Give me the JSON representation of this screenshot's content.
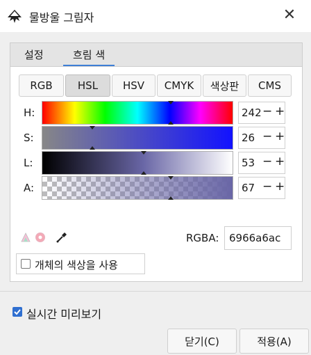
{
  "window": {
    "title": "물방울 그림자",
    "close_label": "✕"
  },
  "tabs": [
    {
      "label": "설정",
      "active": false
    },
    {
      "label": "흐림 색",
      "active": true
    }
  ],
  "color_modes": [
    {
      "label": "RGB",
      "active": false
    },
    {
      "label": "HSL",
      "active": true
    },
    {
      "label": "HSV",
      "active": false
    },
    {
      "label": "CMYK",
      "active": false
    },
    {
      "label": "색상판",
      "active": false
    },
    {
      "label": "CMS",
      "active": false
    }
  ],
  "sliders": [
    {
      "label": "H:",
      "value": "242"
    },
    {
      "label": "S:",
      "value": "26"
    },
    {
      "label": "L:",
      "value": "53"
    },
    {
      "label": "A:",
      "value": "67"
    }
  ],
  "spin": {
    "minus": "−",
    "plus": "+"
  },
  "rgba": {
    "label": "RGBA:",
    "value": "6966a6ac"
  },
  "object_color": {
    "label": "개체의 색상을 사용",
    "checked": false
  },
  "live_preview": {
    "label": "실시간 미리보기",
    "checked": true
  },
  "buttons": {
    "close": "닫기(C)",
    "apply": "적용(A)"
  },
  "colors": {
    "accent": "#3d7fd6",
    "current_color": "#6966a6"
  }
}
